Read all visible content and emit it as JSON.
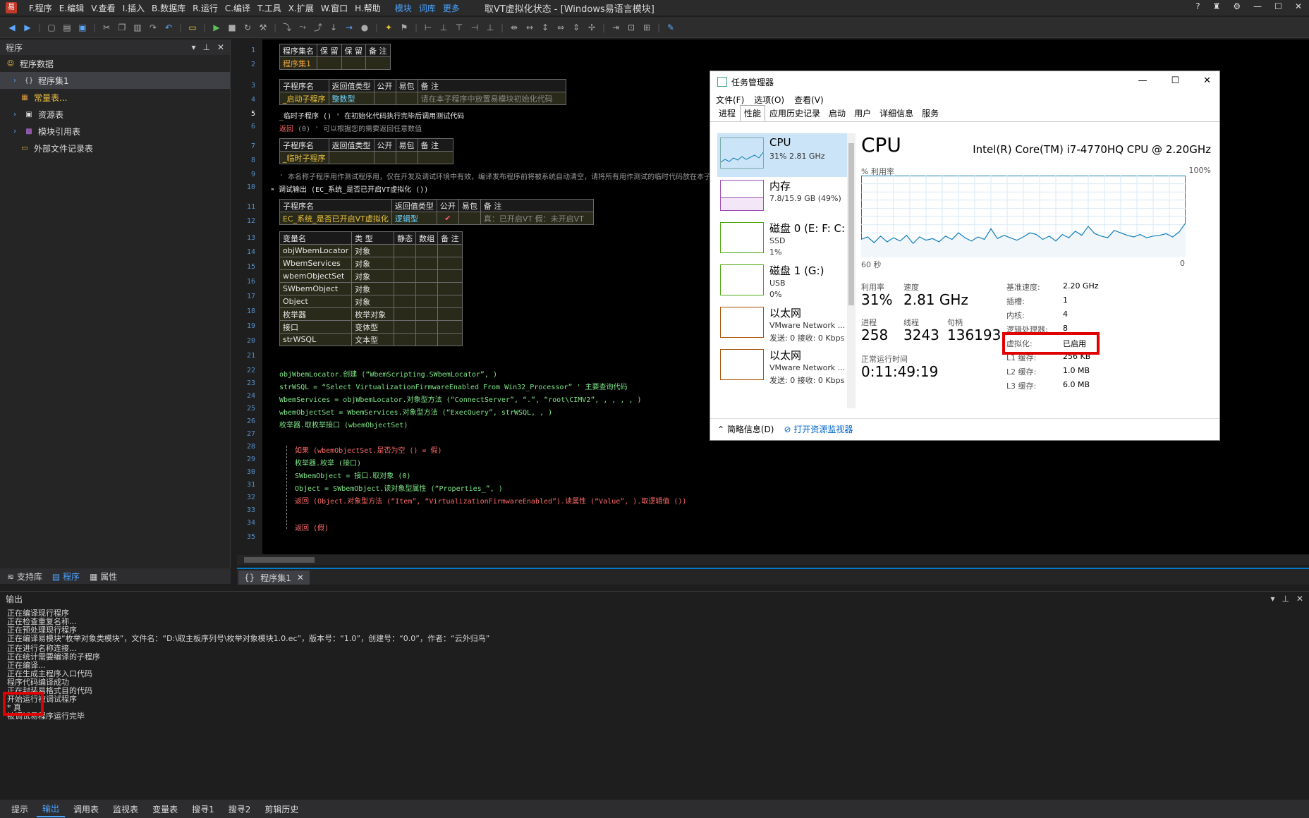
{
  "titlebar": {
    "menus": [
      "F.程序",
      "E.编辑",
      "V.查看",
      "I.插入",
      "B.数据库",
      "R.运行",
      "C.编译",
      "T.工具",
      "X.扩展",
      "W.窗口",
      "H.帮助"
    ],
    "links": [
      "模块",
      "词库",
      "更多"
    ],
    "title": "取VT虚拟化状态 - [Windows易语言模块]"
  },
  "leftpanel": {
    "header": "程序",
    "items": [
      {
        "label": "程序数据",
        "depth": 0
      },
      {
        "label": "程序集1",
        "depth": 1
      },
      {
        "label": "常量表...",
        "depth": 2
      },
      {
        "label": "资源表",
        "depth": 1
      },
      {
        "label": "模块引用表",
        "depth": 1
      },
      {
        "label": "外部文件记录表",
        "depth": 1
      }
    ],
    "bottom_tabs": [
      "支持库",
      "程序",
      "属性"
    ]
  },
  "gutter": [
    "1",
    "2",
    "3",
    "4",
    "5",
    "6",
    "7",
    "8",
    "9",
    "10",
    "11",
    "12",
    "13",
    "14",
    "15",
    "16",
    "17",
    "18",
    "19",
    "20",
    "21",
    "22",
    "23",
    "24",
    "25",
    "26",
    "27",
    "28",
    "29",
    "30",
    "31",
    "32",
    "33",
    "34",
    "35"
  ],
  "editor": {
    "t1": {
      "h": [
        "程序集名",
        "保 留",
        "保 留",
        "备 注"
      ],
      "d": [
        "程序集1",
        "",
        "",
        ""
      ]
    },
    "t2": {
      "h": [
        "子程序名",
        "返回值类型",
        "公开",
        "易包",
        "备 注"
      ],
      "d": [
        "_启动子程序",
        "整数型",
        "",
        "",
        "请在本子程序中放置易模块初始化代码"
      ]
    },
    "line5": "_临时子程序 ()  ' 在初始化代码执行完毕后调用测试代码",
    "line6_kw": "返回",
    "line6_rest": " (0)  ' 可以根据您的需要返回任意数值",
    "t3": {
      "h": [
        "子程序名",
        "返回值类型",
        "公开",
        "易包",
        "备 注"
      ],
      "d": [
        "_临时子程序",
        "",
        "",
        "",
        ""
      ]
    },
    "line9": "' 本名称子程序用作测试程序用，仅在开发及调试环境中有效，编译发布程序前将被系统自动清空，请将所有用作测试的临时代码放在本子程序中。",
    "line10": "调试输出 (EC_系统_是否已开启VT虚拟化 ())",
    "t4": {
      "h": [
        "子程序名",
        "返回值类型",
        "公开",
        "易包",
        "备 注"
      ],
      "d": [
        "EC_系统_是否已开启VT虚拟化",
        "逻辑型",
        "✔",
        "",
        "真：已开启VT    假：未开启VT"
      ]
    },
    "t5": {
      "h": [
        "变量名",
        "类 型",
        "静态",
        "数组",
        "备 注"
      ],
      "rows": [
        [
          "objWbemLocator",
          "对象"
        ],
        [
          "WbemServices",
          "对象"
        ],
        [
          "wbemObjectSet",
          "对象"
        ],
        [
          "SWbemObject",
          "对象"
        ],
        [
          "Object",
          "对象"
        ],
        [
          "枚举器",
          "枚举对象"
        ],
        [
          "接口",
          "变体型"
        ],
        [
          "strWSQL",
          "文本型"
        ]
      ]
    },
    "code": [
      "objWbemLocator.创建 (“WbemScripting.SWbemLocator”, )",
      "strWSQL = “Select VirtualizationFirmwareEnabled From Win32_Processor”  ' 主要查询代码",
      "WbemServices = objWbemLocator.对象型方法 (“ConnectServer”, “.”, “root\\CIMV2”, , , , , )",
      "wbemObjectSet = WbemServices.对象型方法 (“ExecQuery”, strWSQL, , )",
      "枚举器.取枚举接口 (wbemObjectSet)",
      "",
      "如果 (wbemObjectSet.是否为空 () = 假)",
      "枚举器.枚举 (接口)",
      "SWbemObject = 接口.取对象 (0)",
      "Object = SWbemObject.读对象型属性 (“Properties_”, )",
      "返回 (Object.对象型方法 (“Item”, “VirtualizationFirmwareEnabled”).读属性 (“Value”, ).取逻辑值 ())",
      "",
      "返回 (假)"
    ],
    "tab": "程序集1"
  },
  "output": {
    "header": "输出",
    "lines": [
      "正在编译现行程序",
      "正在检查重复名称...",
      "正在预处理现行程序",
      "正在编译易模块“枚举对象类模块”，文件名：“D:\\取主板序列号\\枚举对象模块1.0.ec”，版本号：“1.0”，创建号：“0.0”，作者：“云外归鸟”",
      "正在进行名称连接...",
      "正在统计需要编译的子程序",
      "正在编译...",
      "正在生成主程序入口代码",
      "程序代码编译成功",
      "正在封装易格式目的代码",
      "开始运行被调试程序",
      "* 真",
      "被调试易程序运行完毕"
    ],
    "tabs": [
      "提示",
      "输出",
      "调用表",
      "监视表",
      "变量表",
      "搜寻1",
      "搜寻2",
      "剪辑历史"
    ]
  },
  "taskmgr": {
    "title": "任务管理器",
    "menus": [
      "文件(F)",
      "选项(O)",
      "查看(V)"
    ],
    "tabs": [
      "进程",
      "性能",
      "应用历史记录",
      "启动",
      "用户",
      "详细信息",
      "服务"
    ],
    "resources": [
      {
        "name": "CPU",
        "s1": "31% 2.81 GHz",
        "s2": ""
      },
      {
        "name": "内存",
        "s1": "7.8/15.9 GB (49%)",
        "s2": ""
      },
      {
        "name": "磁盘 0 (E: F: C:",
        "s1": "SSD",
        "s2": "1%"
      },
      {
        "name": "磁盘 1 (G:)",
        "s1": "USB",
        "s2": "0%"
      },
      {
        "name": "以太网",
        "s1": "VMware Network ...",
        "s2": "发送: 0 接收: 0 Kbps"
      },
      {
        "name": "以太网",
        "s1": "VMware Network ...",
        "s2": "发送: 0 接收: 0 Kbps"
      }
    ],
    "cpu_title": "CPU",
    "cpu_model": "Intel(R) Core(TM) i7-4770HQ CPU @ 2.20GHz",
    "util_label": "% 利用率",
    "util_max": "100%",
    "time_left": "60 秒",
    "time_right": "0",
    "stats": {
      "util_l": "利用率",
      "util_v": "31%",
      "speed_l": "速度",
      "speed_v": "2.81 GHz",
      "proc_l": "进程",
      "proc_v": "258",
      "thr_l": "线程",
      "thr_v": "3243",
      "hnd_l": "句柄",
      "hnd_v": "136193",
      "up_l": "正常运行时间",
      "up_v": "0:11:49:19"
    },
    "specs": [
      [
        "基准速度:",
        "2.20 GHz"
      ],
      [
        "插槽:",
        "1"
      ],
      [
        "内核:",
        "4"
      ],
      [
        "逻辑处理器:",
        "8"
      ],
      [
        "虚拟化:",
        "已启用"
      ],
      [
        "L1 缓存:",
        "256 KB"
      ],
      [
        "L2 缓存:",
        "1.0 MB"
      ],
      [
        "L3 缓存:",
        "6.0 MB"
      ]
    ],
    "footer_less": "简略信息(D)",
    "footer_link": "打开资源监视器",
    "chart_data": {
      "type": "line",
      "ylim": [
        0,
        100
      ],
      "values": [
        22,
        25,
        18,
        26,
        19,
        24,
        20,
        27,
        17,
        25,
        21,
        23,
        19,
        26,
        22,
        30,
        24,
        20,
        25,
        22,
        35,
        23,
        27,
        24,
        21,
        25,
        30,
        28,
        22,
        26,
        20,
        28,
        24,
        32,
        27,
        38,
        29,
        26,
        24,
        33,
        30,
        27,
        25,
        28,
        24,
        26,
        27,
        29,
        25,
        31,
        42
      ]
    }
  }
}
